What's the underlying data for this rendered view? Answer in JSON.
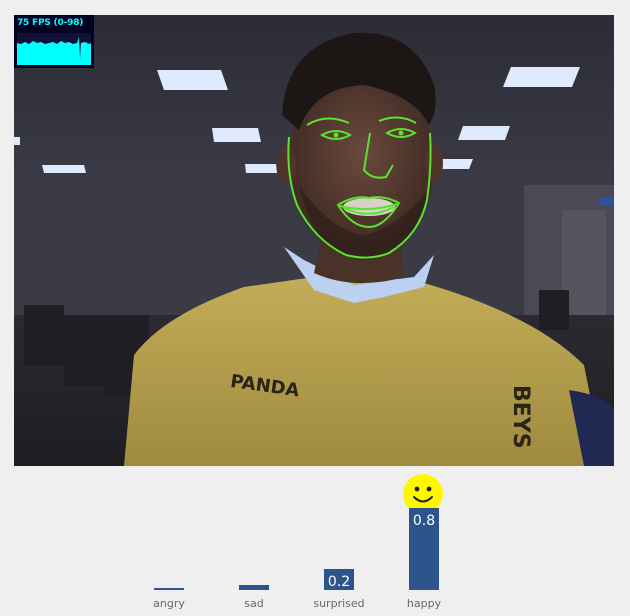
{
  "fps": {
    "label": "75 FPS (0-98)"
  },
  "emotions": [
    {
      "label": "angry",
      "value": 0.02,
      "value_text": ""
    },
    {
      "label": "sad",
      "value": 0.05,
      "value_text": ""
    },
    {
      "label": "surprised",
      "value": 0.2,
      "value_text": "0.2"
    },
    {
      "label": "happy",
      "value": 0.8,
      "value_text": "0.8"
    }
  ],
  "colors": {
    "bar": "#2d558b",
    "fps_fg": "#00ffff",
    "fps_bg": "#000022",
    "smiley": "#fff700",
    "face_mesh": "#5be22f"
  }
}
